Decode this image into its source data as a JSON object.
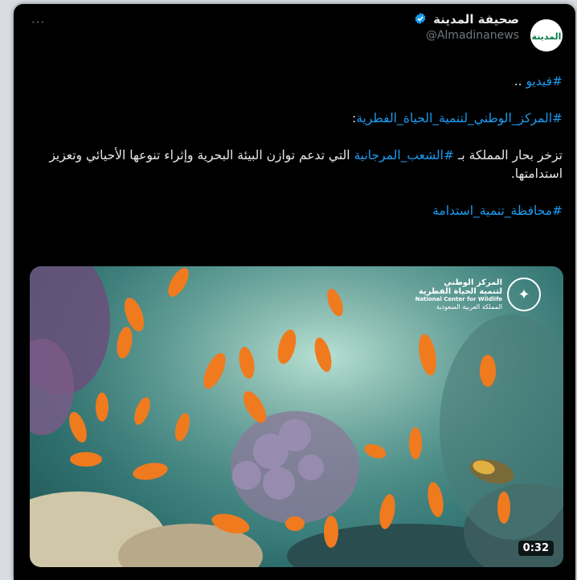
{
  "menu": {
    "icon": "more-horizontal-icon",
    "label": "···"
  },
  "author": {
    "name": "صحيفة المدينة",
    "handle": "@Almadinanews",
    "avatar_text": "المدينة",
    "verified_icon": "verified-badge-icon",
    "verified_color": "#1d9bf0"
  },
  "tweet": {
    "line1_tag": "#فيديو",
    "line1_rest": " ..",
    "line2_tag": "#المركز_الوطني_لتنمية_الحياة_الفطرية",
    "line2_rest": ":",
    "para_part1": "تزخر بحار المملكة بـ ",
    "para_tag": "#الشعب_المرجانية",
    "para_part2": " التي تدعم توازن البيئة البحرية وإثراء تنوعها الأحيائي وتعزيز استدامتها.",
    "line4_tag": "#محافظة_تنمية_استدامة"
  },
  "media": {
    "logo_ar1": "المركز الوطني",
    "logo_ar2": "لتنمية الحياة الفطرية",
    "logo_en": "National Center for Wildlife",
    "logo_ar3": "المملكة العربية السعودية",
    "logo_icon": "palm-swords-emblem-icon",
    "duration": "0:32"
  },
  "colors": {
    "link": "#1d9bf0",
    "background": "#000000",
    "text": "#e7e9ea",
    "muted": "#71767b"
  }
}
